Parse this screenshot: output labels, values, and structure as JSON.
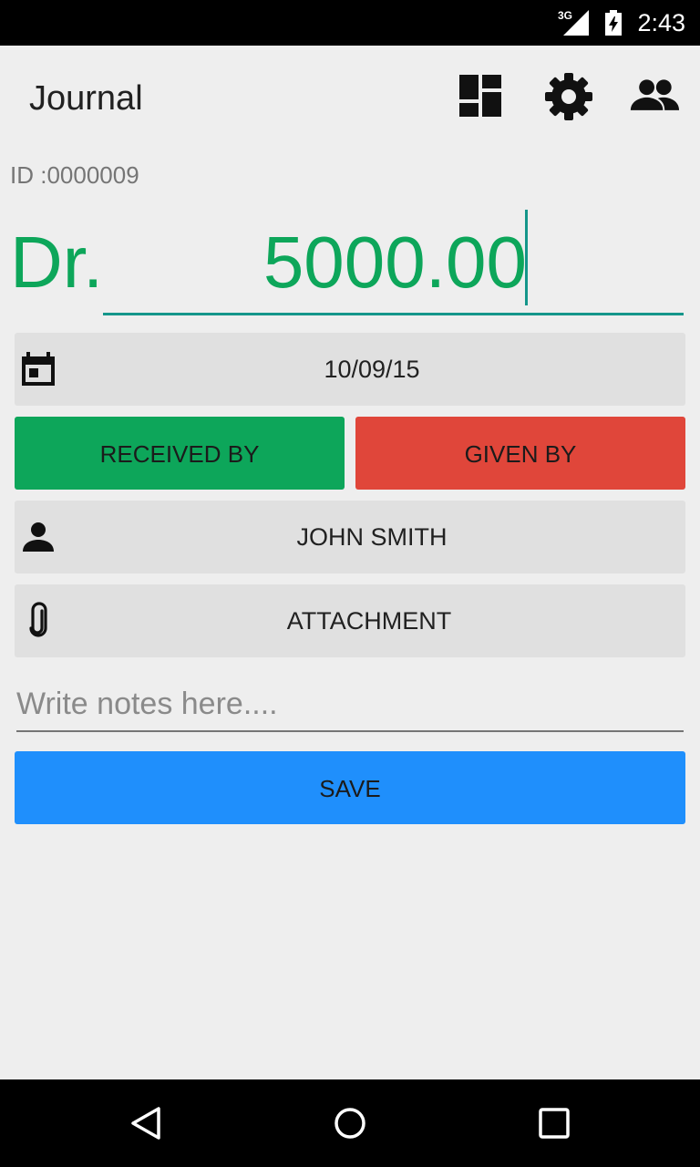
{
  "status_bar": {
    "network": "3G",
    "time": "2:43"
  },
  "app_bar": {
    "title": "Journal",
    "icons": [
      "dashboard-icon",
      "settings-icon",
      "people-icon"
    ]
  },
  "entry": {
    "id_label": "ID :0000009",
    "type_label": "Dr.",
    "amount": "5000.00"
  },
  "date_button": {
    "icon": "calendar-icon",
    "label": "10/09/15"
  },
  "direction": {
    "received_label": "RECEIVED BY",
    "given_label": "GIVEN BY"
  },
  "contact_button": {
    "icon": "person-icon",
    "label": "JOHN SMITH"
  },
  "attachment_button": {
    "icon": "paperclip-icon",
    "label": "ATTACHMENT"
  },
  "notes": {
    "value": "",
    "placeholder": "Write notes here...."
  },
  "save_button": {
    "label": "SAVE"
  },
  "colors": {
    "debit_green": "#0da65a",
    "given_red": "#e0463a",
    "save_blue": "#1f8ffc",
    "accent_teal": "#14968a",
    "background": "#eeeeee"
  },
  "nav_bar": {
    "icons": [
      "back-icon",
      "home-icon",
      "recents-icon"
    ]
  }
}
